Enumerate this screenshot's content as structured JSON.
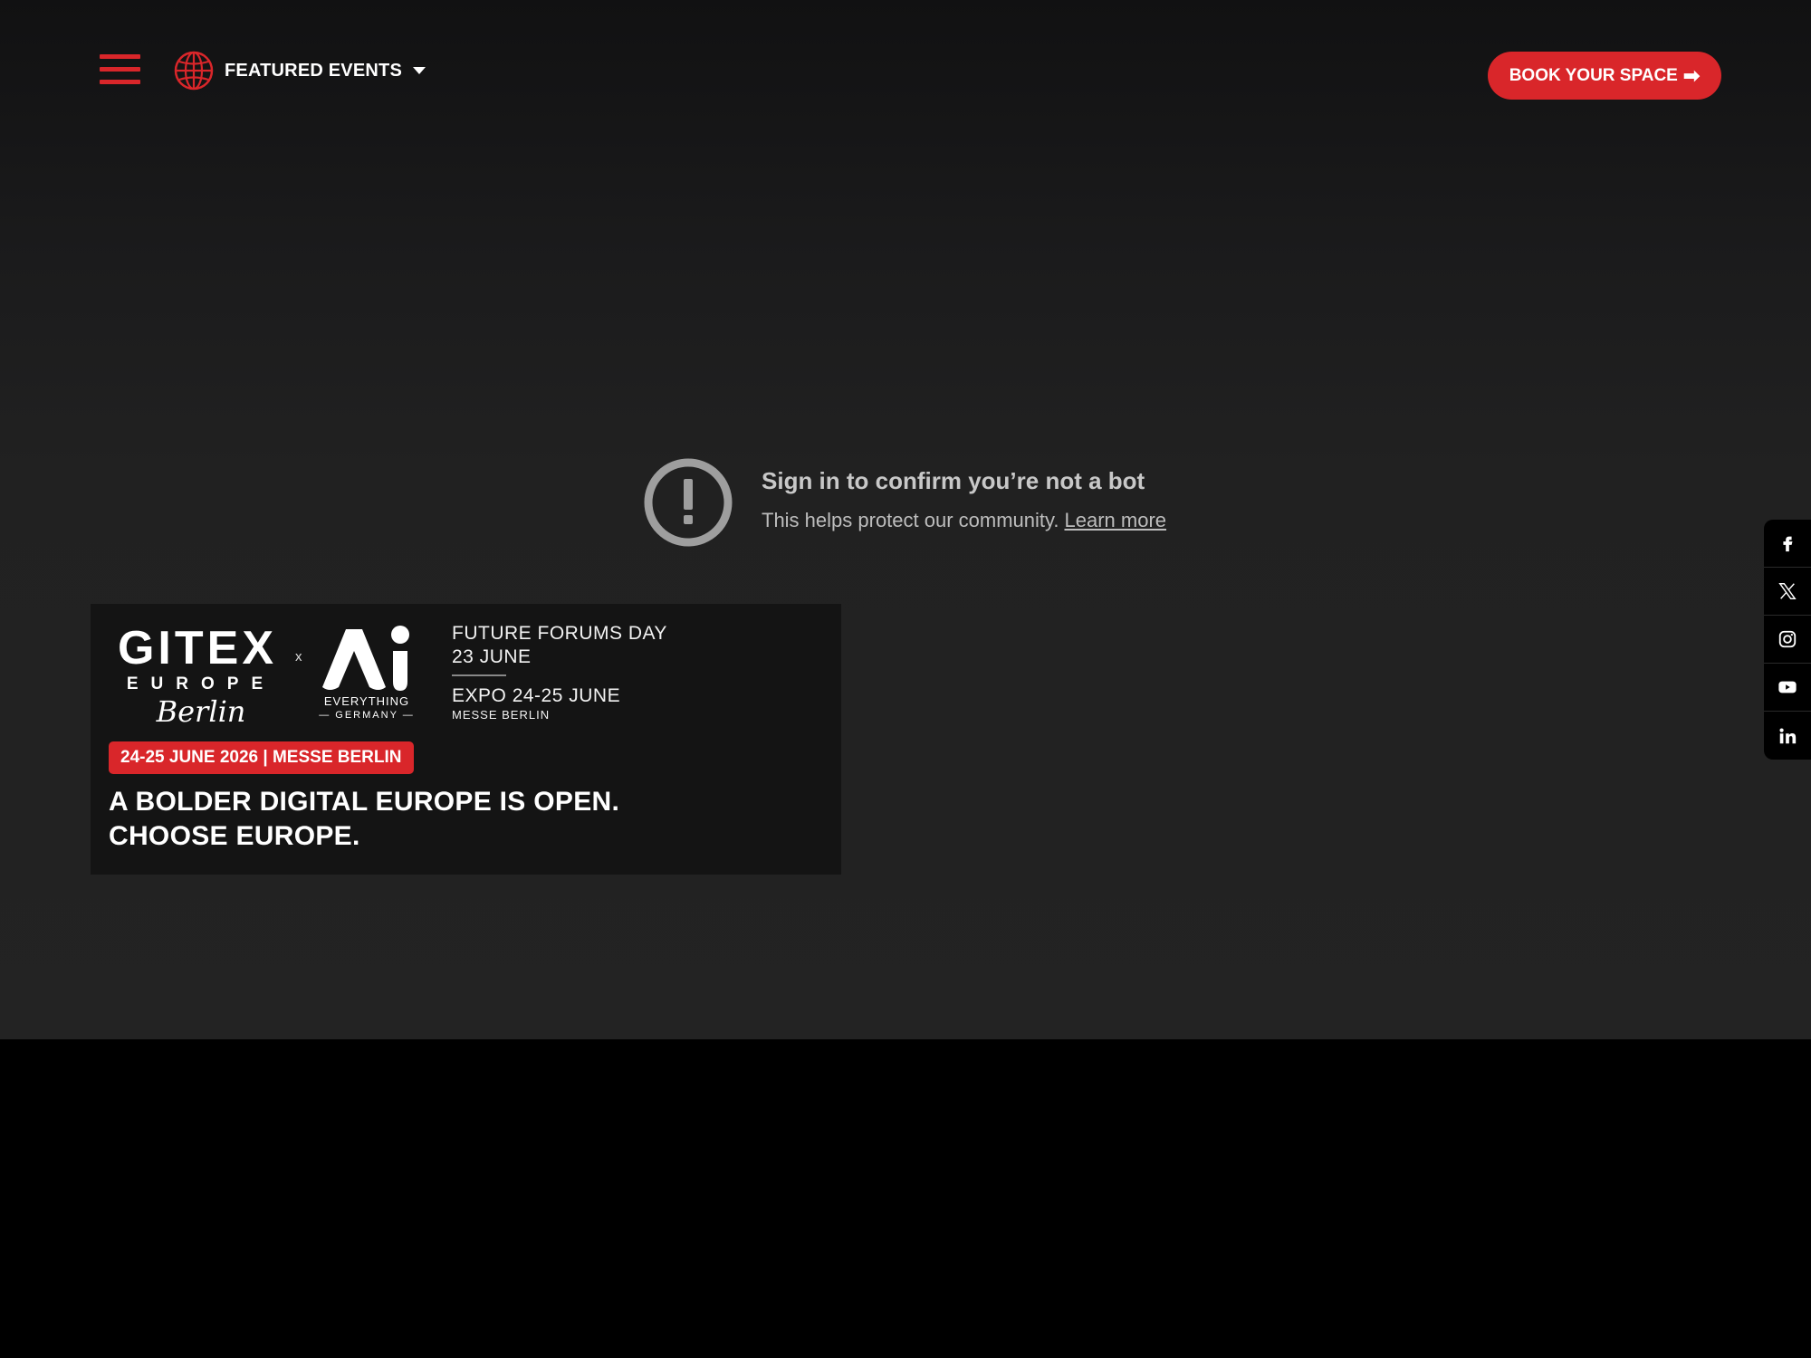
{
  "header": {
    "featured_label": "FEATURED EVENTS",
    "book_label": "BOOK YOUR SPACE",
    "book_arrow": "➡",
    "accent_color": "#d9262a"
  },
  "notice": {
    "title": "Sign in to confirm you’re not a bot",
    "text": "This helps protect our community.",
    "link": "Learn more"
  },
  "banner": {
    "logo_x": "x",
    "event_lines": [
      "FUTURE FORUMS DAY",
      "23 JUNE",
      "EXPO  24-25 JUNE",
      "MESSE BERLIN"
    ],
    "date_badge": "24-25 JUNE 2026 | MESSE BERLIN",
    "headline_line1": "A BOLDER DIGITAL EUROPE IS OPEN.",
    "headline_line2": "CHOOSE EUROPE."
  },
  "logos": {
    "gitex_word": "GITEX",
    "gitex_sub": "EUROPE",
    "gitex_city": "Berlin",
    "ai_sub1": "EVERYTHING",
    "ai_sub2": "— GERMANY —"
  },
  "social": {
    "icons": [
      "facebook-icon",
      "x-icon",
      "instagram-icon",
      "youtube-icon",
      "linkedin-icon"
    ]
  }
}
